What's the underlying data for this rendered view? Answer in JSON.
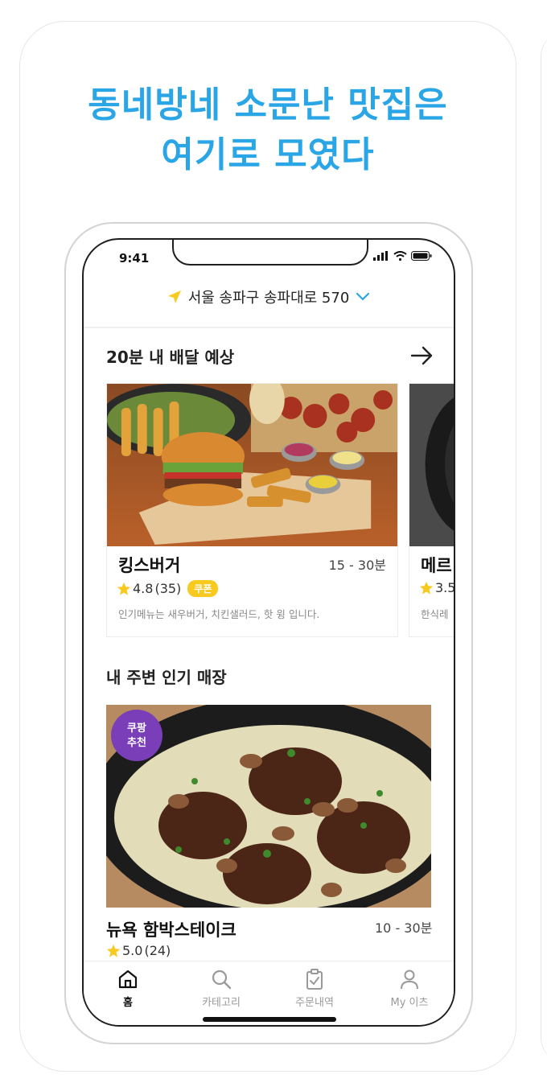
{
  "headline": {
    "line1": "동네방네 소문난 맛집은",
    "line2": "여기로 모였다"
  },
  "status_bar": {
    "time": "9:41"
  },
  "location": {
    "address": "서울 송파구 송파대로 570"
  },
  "delivery_section": {
    "title": "20분 내 배달 예상",
    "stores": [
      {
        "name": "킹스버거",
        "time": "15 - 30분",
        "rating": "4.8",
        "reviews": "(35)",
        "coupon": "쿠폰",
        "description": "인기메뉴는 새우버거, 치킨샐러드, 핫 윙 입니다."
      },
      {
        "name": "메르",
        "rating": "3.5",
        "description": "한식레"
      }
    ]
  },
  "popular_section": {
    "title": "내 주변 인기 매장",
    "store": {
      "badge": "쿠팡 추천",
      "name": "뉴욕 함박스테이크",
      "time": "10 - 30분",
      "rating": "5.0",
      "reviews": "(24)"
    }
  },
  "tabbar": {
    "tabs": [
      {
        "label": "홈",
        "icon": "home-icon",
        "active": true
      },
      {
        "label": "카테고리",
        "icon": "search-icon"
      },
      {
        "label": "주문내역",
        "icon": "clipboard-check-icon"
      },
      {
        "label": "My 이츠",
        "icon": "person-icon"
      }
    ]
  },
  "colors": {
    "headline": "#2aa6e6",
    "accent": "#2aa6e6",
    "star": "#f8c91e",
    "coupon": "#f8c91e",
    "badge": "#7a3fb8"
  }
}
